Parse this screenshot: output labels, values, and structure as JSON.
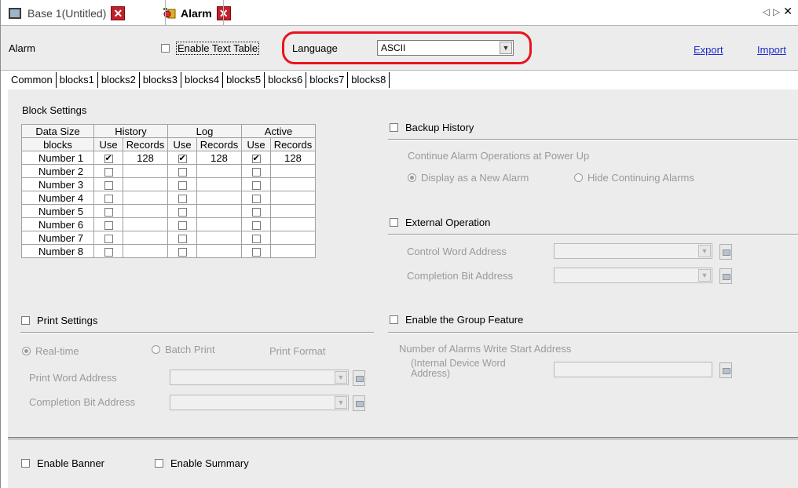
{
  "doc_tabs": [
    {
      "label": "Base 1(Untitled)",
      "icon": "screen-icon"
    },
    {
      "label": "Alarm",
      "icon": "alarm-icon"
    }
  ],
  "nav_glyphs": {
    "left": "◁",
    "right": "▷",
    "close": "✕"
  },
  "top": {
    "section_label": "Alarm",
    "enable_text_table": "Enable Text Table",
    "language_label": "Language",
    "language_value": "ASCII",
    "export": "Export",
    "import": "Import"
  },
  "tabs": [
    "Common",
    "blocks1",
    "blocks2",
    "blocks3",
    "blocks4",
    "blocks5",
    "blocks6",
    "blocks7",
    "blocks8"
  ],
  "block_settings": {
    "title": "Block Settings",
    "header1": [
      "Data Size",
      "History",
      "Log",
      "Active"
    ],
    "header2": [
      "blocks",
      "Use",
      "Records",
      "Use",
      "Records",
      "Use",
      "Records"
    ],
    "rows": [
      {
        "name": "Number 1",
        "h_use": true,
        "h_rec": "128",
        "l_use": true,
        "l_rec": "128",
        "a_use": true,
        "a_rec": "128"
      },
      {
        "name": "Number 2",
        "h_use": false,
        "h_rec": "",
        "l_use": false,
        "l_rec": "",
        "a_use": false,
        "a_rec": ""
      },
      {
        "name": "Number 3",
        "h_use": false,
        "h_rec": "",
        "l_use": false,
        "l_rec": "",
        "a_use": false,
        "a_rec": ""
      },
      {
        "name": "Number 4",
        "h_use": false,
        "h_rec": "",
        "l_use": false,
        "l_rec": "",
        "a_use": false,
        "a_rec": ""
      },
      {
        "name": "Number 5",
        "h_use": false,
        "h_rec": "",
        "l_use": false,
        "l_rec": "",
        "a_use": false,
        "a_rec": ""
      },
      {
        "name": "Number 6",
        "h_use": false,
        "h_rec": "",
        "l_use": false,
        "l_rec": "",
        "a_use": false,
        "a_rec": ""
      },
      {
        "name": "Number 7",
        "h_use": false,
        "h_rec": "",
        "l_use": false,
        "l_rec": "",
        "a_use": false,
        "a_rec": ""
      },
      {
        "name": "Number 8",
        "h_use": false,
        "h_rec": "",
        "l_use": false,
        "l_rec": "",
        "a_use": false,
        "a_rec": ""
      }
    ]
  },
  "print": {
    "title": "Print Settings",
    "realtime": "Real-time",
    "batch": "Batch Print",
    "format": "Print Format",
    "word_address": "Print Word Address",
    "completion_bit": "Completion Bit Address"
  },
  "backup": {
    "title": "Backup History",
    "continue_label": "Continue Alarm Operations at Power Up",
    "display_new": "Display as a New Alarm",
    "hide_continuing": "Hide Continuing Alarms"
  },
  "external": {
    "title": "External Operation",
    "control_word": "Control Word Address",
    "completion_bit": "Completion Bit Address"
  },
  "group": {
    "title": "Enable the Group Feature",
    "write_start": "Number of Alarms Write Start Address",
    "internal_word": "(Internal Device Word Address)"
  },
  "bottom": {
    "enable_banner": "Enable Banner",
    "enable_summary": "Enable Summary"
  },
  "colors": {
    "highlight_ring": "#e8141c",
    "link": "#1a2ccf",
    "close_red": "#c2212a"
  }
}
